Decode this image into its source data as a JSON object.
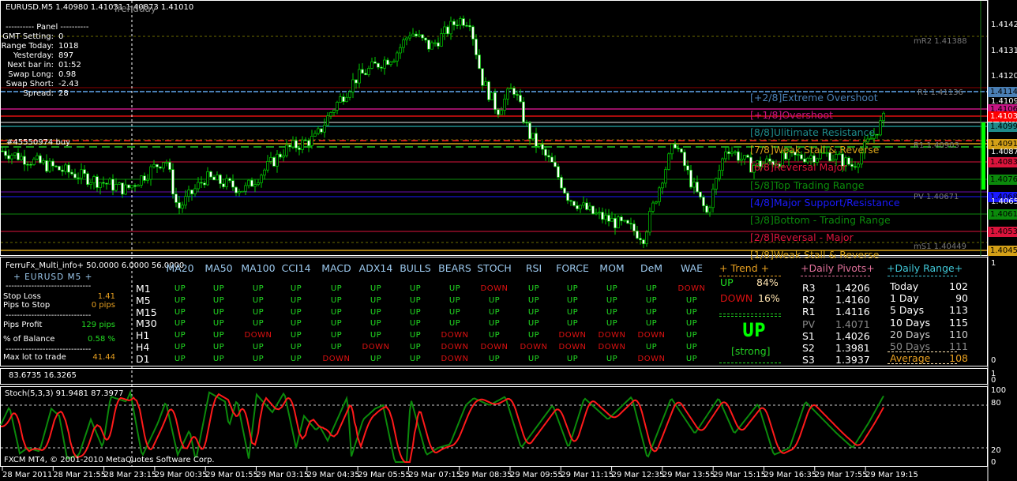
{
  "header": {
    "symbol_line": "EURUSD.M5  1.40980 1.41031 1.40873 1.41010",
    "overlay_text": "Trendday"
  },
  "panel": {
    "title": "---------- Panel ----------",
    "rows": [
      {
        "label": "GMT Setting:",
        "value": "0"
      },
      {
        "label": "Range Today:",
        "value": "1018"
      },
      {
        "label": "Yesterday:",
        "value": "897"
      },
      {
        "label": "Next bar in:",
        "value": "01:52"
      },
      {
        "label": "Swap Long:",
        "value": "0.98"
      },
      {
        "label": "Swap Short:",
        "value": "-2.43"
      },
      {
        "label": "Spread:",
        "value": "28"
      }
    ]
  },
  "order_label": "#45550974 buy",
  "pivot_tags": {
    "mr2": "mR2 1.41388",
    "r1": "R1 1.41136",
    "r1b": "R1 1.40903",
    "pv": "PV 1.40671",
    "ms": "mS1 1.40449"
  },
  "murrey_levels": [
    {
      "label": "[+2/8]Extreme Overshoot",
      "color": "#4a7fb5",
      "price": "1.41144"
    },
    {
      "label": "[+1/8]Overshoot",
      "color": "#c71585",
      "price": "1.41068"
    },
    {
      "label": "[8/8]Ulitimate Resistance",
      "color": "#1e8a8a",
      "price": "1.40991"
    },
    {
      "label": "[7/8]Weak Stall & Reverse",
      "color": "#d4a017",
      "price": "1.40915"
    },
    {
      "label": "[6/8]Reversal Major",
      "color": "#dc143c",
      "price": "1.40835"
    },
    {
      "label": "[5/8]Top Trading Range",
      "color": "#0b8a0b",
      "price": "1.40762"
    },
    {
      "label": "[4/8]Major Support/Resistance",
      "color": "#1a1aff",
      "price": "1.40686"
    },
    {
      "label": "[3/8]Bottom - Trading Range",
      "color": "#0b8a0b",
      "price": "1.40610"
    },
    {
      "label": "[2/8]Reversal - Major",
      "color": "#dc143c",
      "price": "1.40533"
    },
    {
      "label": "[1/8]Weak Stall & Reverse",
      "color": "#d4a017",
      "price": "1.40457"
    }
  ],
  "price_axis": {
    "ticks": [
      "1.41425",
      "1.41315",
      "1.41205",
      "1.41095",
      "1.40875",
      "1.40655"
    ],
    "red_tag": "1.41039",
    "white_tag": "1.41010"
  },
  "price_path": [
    [
      0,
      1.40885
    ],
    [
      60,
      1.40817
    ],
    [
      110,
      1.40765
    ],
    [
      160,
      1.40713
    ],
    [
      210,
      1.40851
    ],
    [
      225,
      1.40627
    ],
    [
      260,
      1.40765
    ],
    [
      310,
      1.40713
    ],
    [
      360,
      1.40885
    ],
    [
      400,
      1.40937
    ],
    [
      420,
      1.41057
    ],
    [
      450,
      1.41195
    ],
    [
      480,
      1.41263
    ],
    [
      500,
      1.41298
    ],
    [
      520,
      1.41401
    ],
    [
      545,
      1.41332
    ],
    [
      580,
      1.41452
    ],
    [
      595,
      1.41452
    ],
    [
      610,
      1.41195
    ],
    [
      630,
      1.41057
    ],
    [
      650,
      1.4116
    ],
    [
      670,
      1.40954
    ],
    [
      700,
      1.40817
    ],
    [
      720,
      1.40679
    ],
    [
      750,
      1.4061
    ],
    [
      800,
      1.40542
    ],
    [
      815,
      1.40507
    ],
    [
      840,
      1.40782
    ],
    [
      855,
      1.4092
    ],
    [
      875,
      1.40748
    ],
    [
      895,
      1.4061
    ],
    [
      920,
      1.40902
    ],
    [
      950,
      1.40817
    ],
    [
      1000,
      1.40851
    ],
    [
      1050,
      1.40868
    ],
    [
      1080,
      1.40817
    ],
    [
      1120,
      1.41023
    ]
  ],
  "info": {
    "title": "FerruFx_Multi_info+ 50.0000 6.0000 56.0000",
    "pair": "+ EURUSD  M5  +",
    "sep": "------------------------------",
    "stats": [
      {
        "label": "Stop Loss",
        "value": "1.41",
        "color": "#e8a020"
      },
      {
        "label": "Pips to Stop",
        "value": "0 pips",
        "color": "#e8a020"
      },
      {
        "label": "Pips Profit",
        "value": "129 pips",
        "color": "#22dd22"
      },
      {
        "label": "% of Balance",
        "value": "0.58 %",
        "color": "#22dd22"
      },
      {
        "label": "Max lot to trade",
        "value": "41.44",
        "color": "#e8a020"
      }
    ]
  },
  "matrix": {
    "columns": [
      "MA20",
      "MA50",
      "MA100",
      "CCI14",
      "MACD",
      "ADX14",
      "BULLS",
      "BEARS",
      "STOCH",
      "RSI",
      "FORCE",
      "MOM",
      "DeM",
      "WAE"
    ],
    "rows": [
      {
        "tf": "M1",
        "values": [
          "UP",
          "UP",
          "UP",
          "UP",
          "UP",
          "UP",
          "UP",
          "UP",
          "DOWN",
          "UP",
          "UP",
          "UP",
          "UP",
          "DOWN"
        ]
      },
      {
        "tf": "M5",
        "values": [
          "UP",
          "UP",
          "UP",
          "UP",
          "UP",
          "UP",
          "UP",
          "UP",
          "UP",
          "UP",
          "UP",
          "UP",
          "UP",
          "UP"
        ]
      },
      {
        "tf": "M15",
        "values": [
          "UP",
          "UP",
          "UP",
          "UP",
          "UP",
          "UP",
          "UP",
          "UP",
          "UP",
          "UP",
          "UP",
          "UP",
          "UP",
          "UP"
        ]
      },
      {
        "tf": "M30",
        "values": [
          "UP",
          "UP",
          "UP",
          "UP",
          "UP",
          "UP",
          "UP",
          "UP",
          "UP",
          "UP",
          "UP",
          "UP",
          "UP",
          "UP"
        ]
      },
      {
        "tf": "H1",
        "values": [
          "UP",
          "UP",
          "DOWN",
          "UP",
          "UP",
          "UP",
          "UP",
          "DOWN",
          "UP",
          "UP",
          "DOWN",
          "DOWN",
          "DOWN",
          "UP"
        ]
      },
      {
        "tf": "H4",
        "values": [
          "UP",
          "UP",
          "UP",
          "UP",
          "UP",
          "DOWN",
          "UP",
          "DOWN",
          "DOWN",
          "DOWN",
          "DOWN",
          "DOWN",
          "UP",
          "UP"
        ]
      },
      {
        "tf": "D1",
        "values": [
          "UP",
          "UP",
          "UP",
          "UP",
          "DOWN",
          "UP",
          "UP",
          "DOWN",
          "UP",
          "UP",
          "UP",
          "UP",
          "DOWN",
          "UP"
        ]
      }
    ]
  },
  "trend": {
    "title": "+   Trend   +",
    "up_label": "UP",
    "up_pct": "84%",
    "down_label": "DOWN",
    "down_pct": "16%",
    "direction": "UP",
    "strength": "[strong]"
  },
  "pivots": {
    "title": "+Daily Pivots+",
    "rows": [
      {
        "k": "R3",
        "v": "1.4206"
      },
      {
        "k": "R2",
        "v": "1.4160"
      },
      {
        "k": "R1",
        "v": "1.4116"
      },
      {
        "k": "PV",
        "v": "1.4071"
      },
      {
        "k": "S1",
        "v": "1.4026"
      },
      {
        "k": "S2",
        "v": "1.3981"
      },
      {
        "k": "S3",
        "v": "1.3937"
      }
    ]
  },
  "ranges": {
    "title": "+Daily Range+",
    "rows": [
      {
        "k": "Today",
        "v": "102"
      },
      {
        "k": "1 Day",
        "v": "90"
      },
      {
        "k": "5 Days",
        "v": "113"
      },
      {
        "k": "10 Days",
        "v": "115"
      },
      {
        "k": "20 Days",
        "v": "110"
      },
      {
        "k": "50 Days",
        "v": "111"
      },
      {
        "k": "Average",
        "v": "108"
      }
    ]
  },
  "sub_axis": {
    "top": "1",
    "bottom": "0"
  },
  "mini_panel": {
    "values": "83.6735 16.3265"
  },
  "stoch": {
    "title": "Stoch(5,3,3) 91.9481 87.3977",
    "copyright": "FXCM MT4, © 2001-2010 MetaQuotes Software Corp.",
    "ticks": [
      "100",
      "80",
      "20",
      "0"
    ],
    "main": [
      [
        0,
        50
      ],
      [
        12,
        78
      ],
      [
        25,
        12
      ],
      [
        35,
        20
      ],
      [
        50,
        15
      ],
      [
        65,
        75
      ],
      [
        75,
        65
      ],
      [
        85,
        5
      ],
      [
        100,
        10
      ],
      [
        115,
        60
      ],
      [
        130,
        20
      ],
      [
        140,
        92
      ],
      [
        160,
        85
      ],
      [
        165,
        98
      ],
      [
        180,
        8
      ],
      [
        200,
        55
      ],
      [
        210,
        85
      ],
      [
        225,
        10
      ],
      [
        240,
        45
      ],
      [
        248,
        2
      ],
      [
        265,
        98
      ],
      [
        285,
        85
      ],
      [
        290,
        50
      ],
      [
        300,
        88
      ],
      [
        315,
        5
      ],
      [
        325,
        95
      ],
      [
        345,
        70
      ],
      [
        360,
        98
      ],
      [
        375,
        20
      ],
      [
        385,
        65
      ],
      [
        400,
        45
      ],
      [
        405,
        50
      ],
      [
        415,
        30
      ],
      [
        440,
        92
      ],
      [
        445,
        8
      ],
      [
        460,
        60
      ],
      [
        475,
        75
      ],
      [
        485,
        80
      ],
      [
        500,
        0
      ],
      [
        515,
        0
      ],
      [
        520,
        90
      ],
      [
        540,
        10
      ],
      [
        555,
        20
      ],
      [
        570,
        25
      ],
      [
        590,
        80
      ],
      [
        600,
        90
      ],
      [
        620,
        80
      ],
      [
        640,
        92
      ],
      [
        660,
        20
      ],
      [
        700,
        80
      ],
      [
        720,
        20
      ],
      [
        740,
        90
      ],
      [
        770,
        60
      ],
      [
        800,
        92
      ],
      [
        820,
        5
      ],
      [
        850,
        90
      ],
      [
        880,
        40
      ],
      [
        910,
        90
      ],
      [
        930,
        40
      ],
      [
        960,
        82
      ],
      [
        980,
        10
      ],
      [
        1000,
        20
      ],
      [
        1020,
        85
      ],
      [
        1060,
        40
      ],
      [
        1080,
        20
      ],
      [
        1100,
        55
      ],
      [
        1120,
        95
      ]
    ]
  },
  "time_axis": [
    "28 Mar 2011",
    "28 Mar 21:55",
    "28 Mar 23:15",
    "29 Mar 00:35",
    "29 Mar 01:55",
    "29 Mar 03:15",
    "29 Mar 04:35",
    "29 Mar 05:55",
    "29 Mar 07:15",
    "29 Mar 08:35",
    "29 Mar 09:55",
    "29 Mar 11:15",
    "29 Mar 12:35",
    "29 Mar 13:55",
    "29 Mar 15:15",
    "29 Mar 16:35",
    "29 Mar 17:55",
    "29 Mar 19:15"
  ],
  "colors": {
    "up": "#22dd22",
    "down": "#dd1111",
    "bull": "#00ff00",
    "stoch_main": "#0b8a0b",
    "stoch_signal": "#ff1a1a"
  }
}
